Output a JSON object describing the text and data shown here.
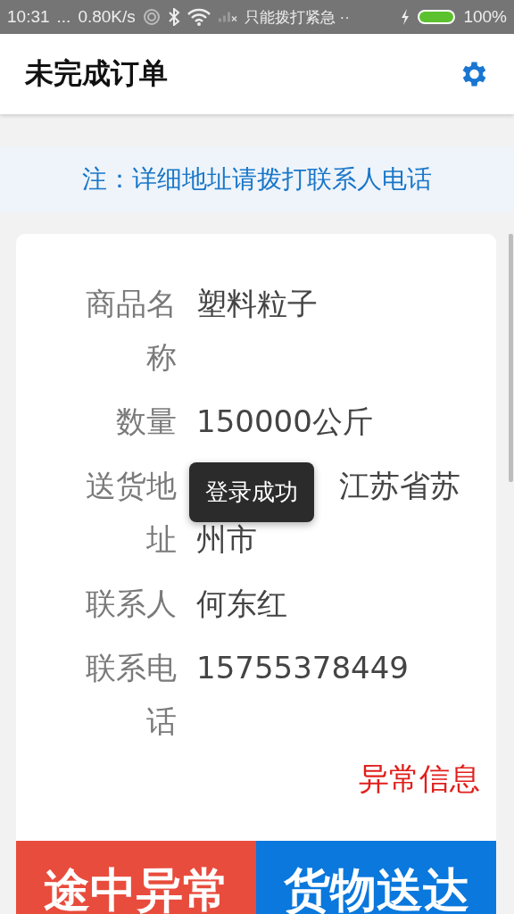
{
  "status_bar": {
    "time": "10:31",
    "dots": "...",
    "speed": "0.80K/s",
    "carrier": "只能拨打紧急 ··",
    "battery": "100%"
  },
  "app_bar": {
    "title": "未完成订单"
  },
  "notice": "注：详细地址请拨打联系人电话",
  "order": {
    "fields": [
      {
        "label": "商品名称",
        "value": "塑料粒子"
      },
      {
        "label": "数量",
        "value": "150000公斤"
      },
      {
        "label": "送货地址",
        "value_lines": [
          "江苏省苏",
          "州市"
        ]
      },
      {
        "label": "联系人",
        "value": "何东红"
      },
      {
        "label": "联系电话",
        "value": "15755378449"
      }
    ],
    "exception_link": "异常信息"
  },
  "actions": [
    {
      "label": "途中异常",
      "kind": "danger"
    },
    {
      "label": "货物送达",
      "kind": "primary"
    }
  ],
  "toast": "登录成功"
}
